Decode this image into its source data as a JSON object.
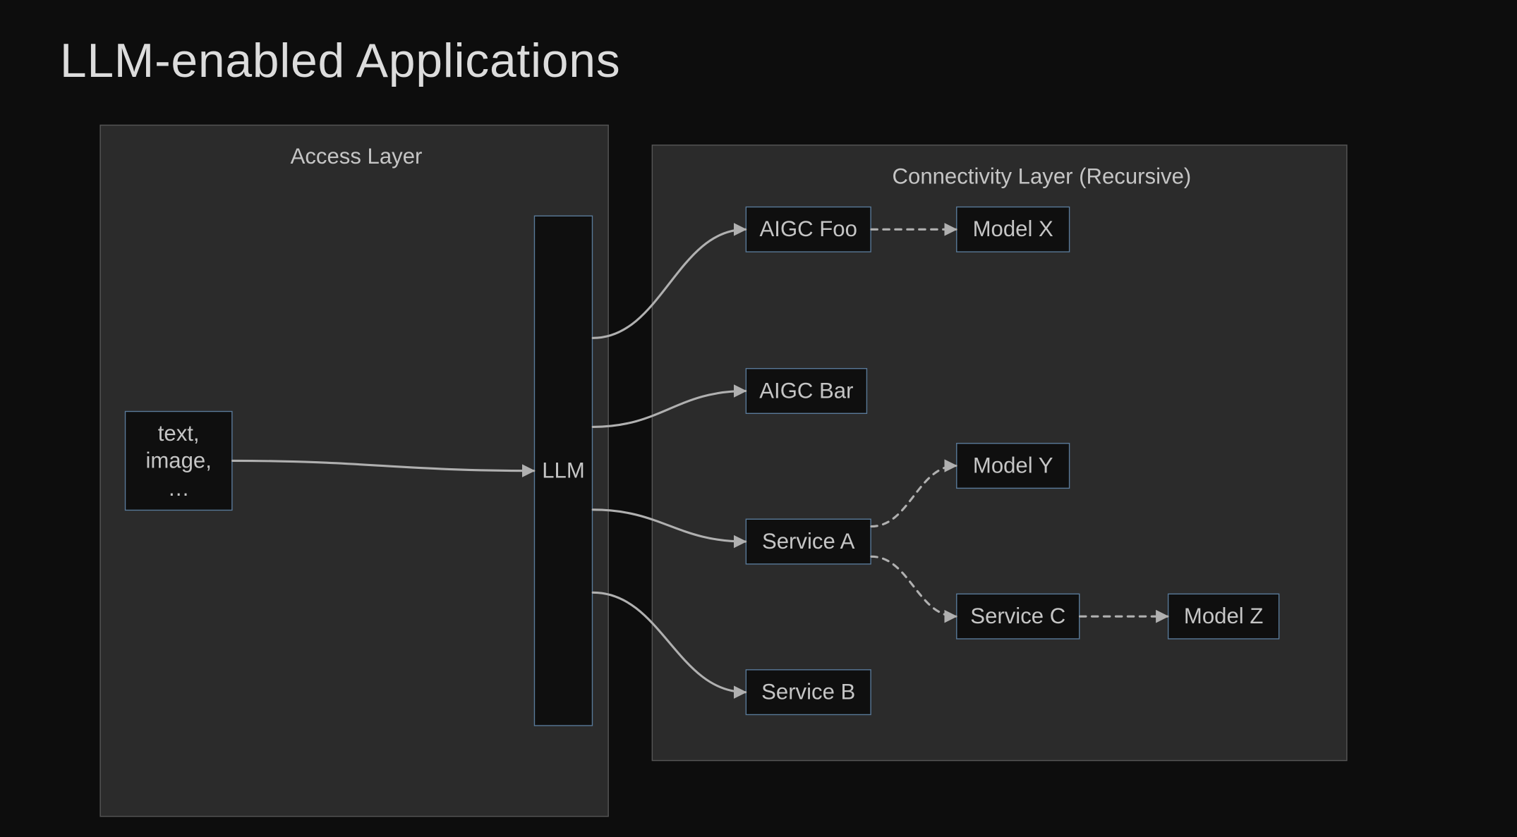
{
  "title": "LLM-enabled Applications",
  "panels": {
    "access": {
      "title": "Access Layer"
    },
    "connectivity": {
      "title": "Connectivity Layer (Recursive)"
    }
  },
  "nodes": {
    "input": "text,\nimage,\n…",
    "llm": "LLM",
    "aigc_foo": "AIGC Foo",
    "aigc_bar": "AIGC Bar",
    "service_a": "Service A",
    "service_b": "Service B",
    "model_x": "Model X",
    "model_y": "Model Y",
    "service_c": "Service C",
    "model_z": "Model Z"
  },
  "edges": [
    {
      "from": "input",
      "to": "llm",
      "style": "solid"
    },
    {
      "from": "llm",
      "to": "aigc_foo",
      "style": "solid"
    },
    {
      "from": "llm",
      "to": "aigc_bar",
      "style": "solid"
    },
    {
      "from": "llm",
      "to": "service_a",
      "style": "solid"
    },
    {
      "from": "llm",
      "to": "service_b",
      "style": "solid"
    },
    {
      "from": "aigc_foo",
      "to": "model_x",
      "style": "dotted"
    },
    {
      "from": "service_a",
      "to": "model_y",
      "style": "dotted"
    },
    {
      "from": "service_a",
      "to": "service_c",
      "style": "dotted"
    },
    {
      "from": "service_c",
      "to": "model_z",
      "style": "dotted"
    }
  ]
}
